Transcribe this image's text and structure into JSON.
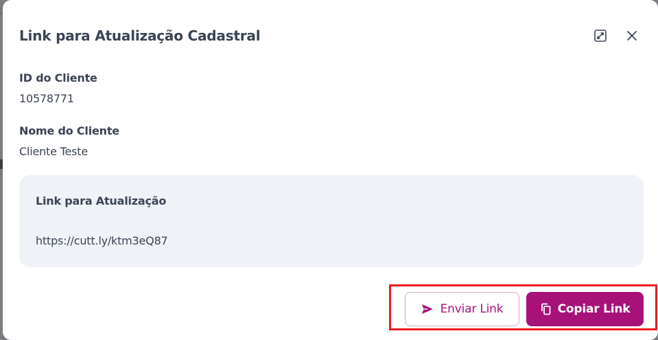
{
  "modal": {
    "title": "Link para Atualização Cadastral",
    "expand_icon": "expand-icon",
    "close_icon": "close-icon"
  },
  "client": {
    "id_label": "ID do Cliente",
    "id_value": "10578771",
    "name_label": "Nome do Cliente",
    "name_value": "Cliente Teste"
  },
  "link_section": {
    "title": "Link para Atualização",
    "url": "https://cutt.ly/ktm3eQ87"
  },
  "actions": {
    "send_label": "Enviar Link",
    "send_icon": "send-icon",
    "copy_label": "Copiar Link",
    "copy_icon": "copy-icon"
  },
  "colors": {
    "primary": "#a6127a",
    "text": "#3b4453",
    "card_background": "#eff2f7",
    "highlight": "#ee1c1c"
  }
}
